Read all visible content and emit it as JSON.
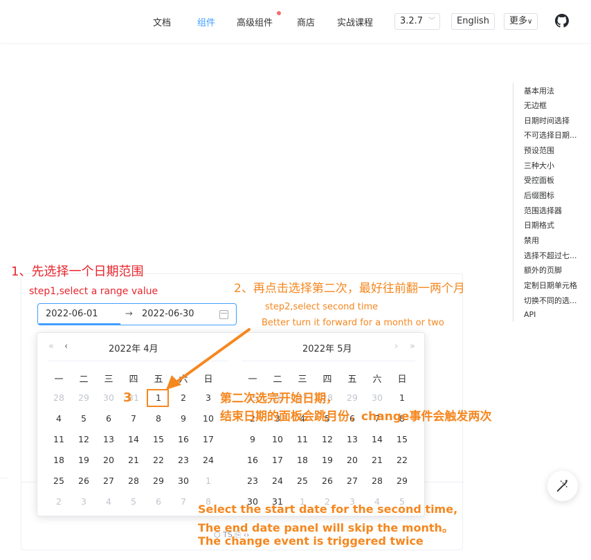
{
  "nav": {
    "items": [
      "文档",
      "组件",
      "高级组件",
      "商店",
      "实战课程"
    ],
    "version": "3.2.7",
    "version_chevron": "﹀",
    "language": "English",
    "more": "更多",
    "more_chevron": "∨",
    "github_icon": "github-icon"
  },
  "toc": [
    "基本用法",
    "无边框",
    "日期时间选择",
    "不可选择日期...",
    "预设范围",
    "三种大小",
    "受控面板",
    "后缀图标",
    "范围选择器",
    "日期格式",
    "禁用",
    "选择不超过七...",
    "额外的页脚",
    "定制日期单元格",
    "切换不同的选...",
    "API"
  ],
  "range": {
    "start": "2022-06-01",
    "separator": "→",
    "end": "2022-06-30"
  },
  "panel": {
    "left_title": "2022年  4月",
    "right_title": "2022年  5月",
    "prev_year": "«",
    "prev_month": "‹",
    "next_month": "›",
    "next_year": "»",
    "weekdays": [
      "一",
      "二",
      "三",
      "四",
      "五",
      "六",
      "日"
    ],
    "left_rows": [
      [
        "28",
        "29",
        "30",
        "31",
        "1",
        "2",
        "3"
      ],
      [
        "4",
        "5",
        "6",
        "7",
        "8",
        "9",
        "10"
      ],
      [
        "11",
        "12",
        "13",
        "14",
        "15",
        "16",
        "17"
      ],
      [
        "18",
        "19",
        "20",
        "21",
        "22",
        "23",
        "24"
      ],
      [
        "25",
        "26",
        "27",
        "28",
        "29",
        "30",
        "1"
      ],
      [
        "2",
        "3",
        "4",
        "5",
        "6",
        "7",
        "8"
      ]
    ],
    "right_rows": [
      [
        "25",
        "26",
        "27",
        "28",
        "29",
        "30",
        "1"
      ],
      [
        "2",
        "3",
        "4",
        "5",
        "6",
        "7",
        "8"
      ],
      [
        "9",
        "10",
        "11",
        "12",
        "13",
        "14",
        "15"
      ],
      [
        "16",
        "17",
        "18",
        "19",
        "20",
        "21",
        "22"
      ],
      [
        "23",
        "24",
        "25",
        "26",
        "27",
        "28",
        "29"
      ],
      [
        "30",
        "31",
        "1",
        "2",
        "3",
        "4",
        "5"
      ]
    ]
  },
  "card_icons": "⬡  TS  ⎘  ‹›",
  "annotations": {
    "step1_cn": "1、先选择一个日期范围",
    "step1_en": "step1,select a range value",
    "step2_cn": "2、再点击选择第二次，最好往前翻一两个月",
    "step2_en": "step2,select second time",
    "step2_en2": "Better turn it forward for a month or two",
    "mark_num": "3",
    "result_cn1": "第二次选完开始日期，",
    "result_cn2": "结束日期的面板会跳月份，change事件会触发两次",
    "result_en1": "Select the start date for the second time,",
    "result_en2": "The end date panel will skip the month。",
    "result_en3": "The change event is triggered twice"
  },
  "fab_icon": "magic-wand-icon",
  "colors": {
    "accent": "#409eff",
    "annotation_red": "#e8262c",
    "annotation_orange": "#f5871f"
  }
}
